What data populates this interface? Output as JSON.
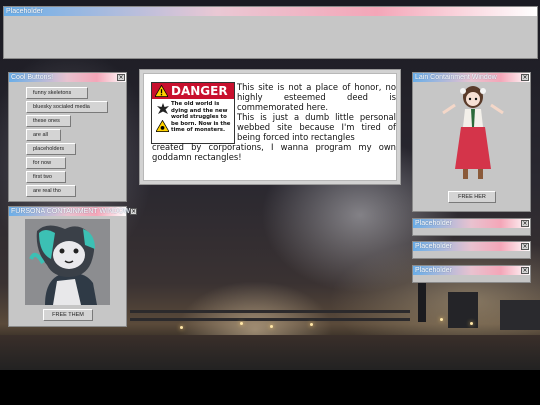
{
  "top_window": {
    "title": "Placeholder"
  },
  "cool_buttons": {
    "title": "Cool Buttons!",
    "items": [
      {
        "label": "funny skeletons"
      },
      {
        "label": "bluesky socialed media"
      },
      {
        "label": "these ones"
      },
      {
        "label": "are all"
      },
      {
        "label": "placeholders"
      },
      {
        "label": "for now"
      },
      {
        "label": "first two"
      },
      {
        "label": "are real tho"
      }
    ]
  },
  "fursona_window": {
    "title": "FURSONA CONTAINMENT WINDOW",
    "button": "FREE THEM"
  },
  "main_window": {
    "danger_heading": "DANGER",
    "danger_text": "The old world is dying and the new world struggles to be born. Now is the time of monsters.",
    "paragraph1": "This site is not a place of honor, no highly esteemed deed is commemorated here.",
    "paragraph2_a": "This is just a dumb little personal webbed site because I'm tired of being forced into rectangles",
    "paragraph2_b": "created by corporations, I wanna program my own goddamn rectangles!"
  },
  "containment_window": {
    "title": "Lain Containment Window",
    "button": "FREE HER"
  },
  "placeholders": [
    {
      "title": "Placeholder"
    },
    {
      "title": "Placeholder"
    },
    {
      "title": "Placeholder"
    }
  ],
  "colors": {
    "titlebar_blue": "#6aaee8",
    "titlebar_pink": "#f4a6b8",
    "window_gray": "#c6c6c6",
    "danger_red": "#c8102e"
  }
}
